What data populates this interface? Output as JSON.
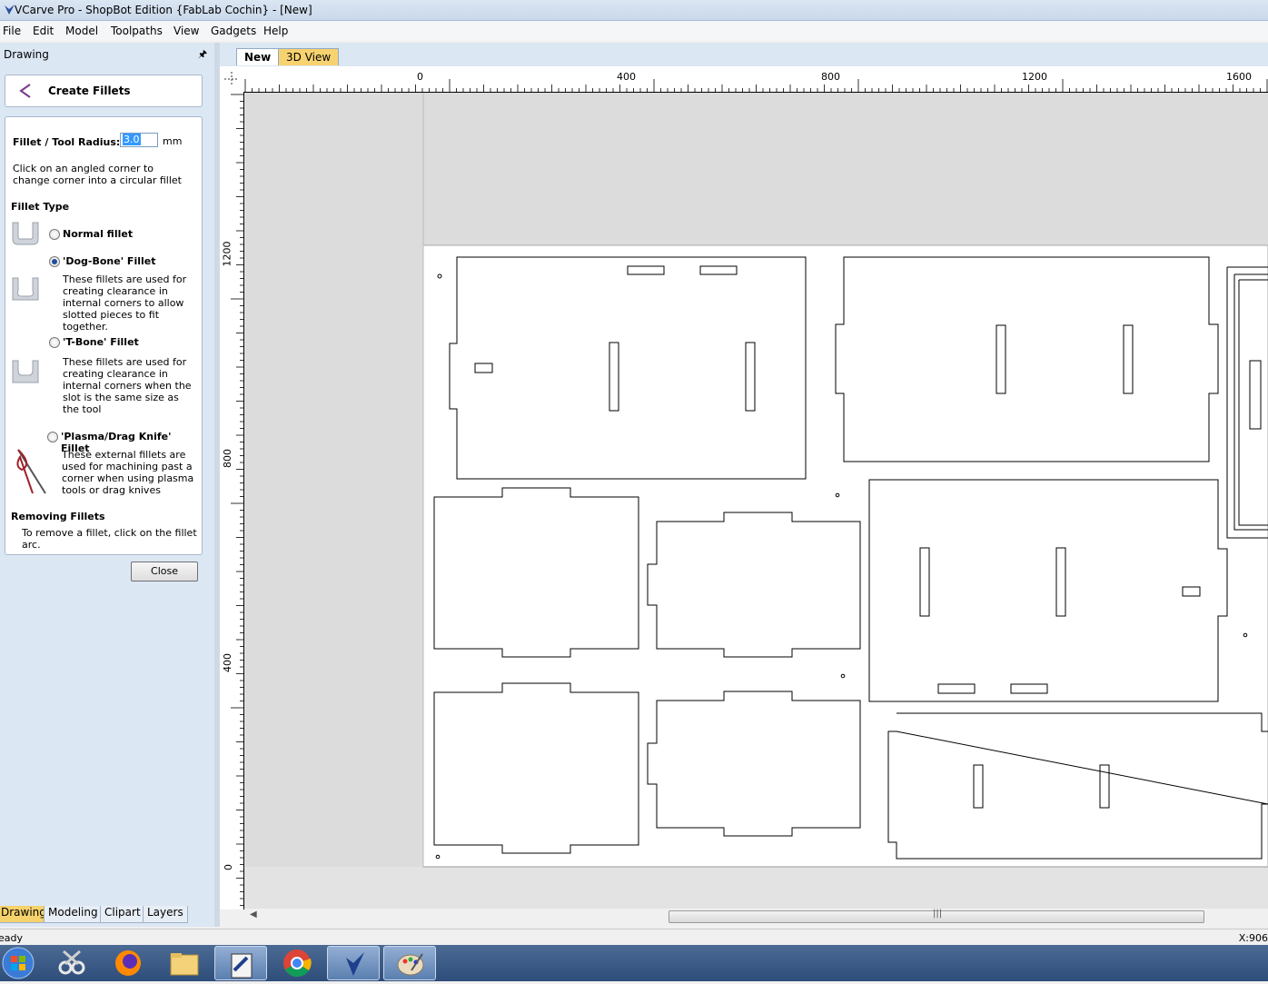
{
  "window": {
    "title": "VCarve Pro - ShopBot Edition {FabLab Cochin} - [New]"
  },
  "menu": [
    "File",
    "Edit",
    "Model",
    "Toolpaths",
    "View",
    "Gadgets",
    "Help"
  ],
  "panel": {
    "header": "Drawing",
    "pin_icon": "pin-icon",
    "title": "Create Fillets",
    "radius_label": "Fillet / Tool Radius:",
    "radius_value": "3.0",
    "radius_unit": "mm",
    "instruction": "Click on an angled corner to change corner into a circular fillet",
    "fillet_type_heading": "Fillet Type",
    "options": [
      {
        "label": "Normal fillet",
        "checked": false
      },
      {
        "label": "'Dog-Bone' Fillet",
        "checked": true,
        "desc": "These fillets are used for creating clearance in internal corners to allow slotted pieces to fit together."
      },
      {
        "label": "'T-Bone' Fillet",
        "checked": false,
        "desc": "These fillets are used for creating clearance in internal corners when the slot is the same size as the tool"
      },
      {
        "label": "'Plasma/Drag Knife' Fillet",
        "checked": false,
        "desc": "These external fillets are used for machining past a corner when using plasma tools or drag knives"
      }
    ],
    "removing_heading": "Removing Fillets",
    "removing_text": "To remove a fillet, click on the fillet arc.",
    "close_label": "Close"
  },
  "bottom_tabs": [
    {
      "label": "Drawing",
      "active": true
    },
    {
      "label": "Modeling",
      "active": false
    },
    {
      "label": "Clipart",
      "active": false
    },
    {
      "label": "Layers",
      "active": false
    }
  ],
  "doc_tabs": [
    {
      "label": "New",
      "active": true
    },
    {
      "label": "3D View",
      "active": false
    }
  ],
  "ruler": {
    "h_labels": [
      "0",
      "400",
      "800",
      "1200",
      "1600"
    ],
    "v_labels": [
      "1200",
      "800",
      "400",
      "0"
    ]
  },
  "status": {
    "left": "eady",
    "right": "X:906"
  },
  "taskbar": [
    "start-orb-icon",
    "snipping-tool-icon",
    "firefox-icon",
    "file-explorer-icon",
    "vcarve-doc-icon",
    "chrome-icon",
    "vcarve-app-icon",
    "paint-icon"
  ],
  "colors": {
    "panel_bg": "#dce7f4",
    "active_tab": "#f7d36f",
    "canvas_bg": "#e3e3e3",
    "sheet": "#ffffff"
  }
}
